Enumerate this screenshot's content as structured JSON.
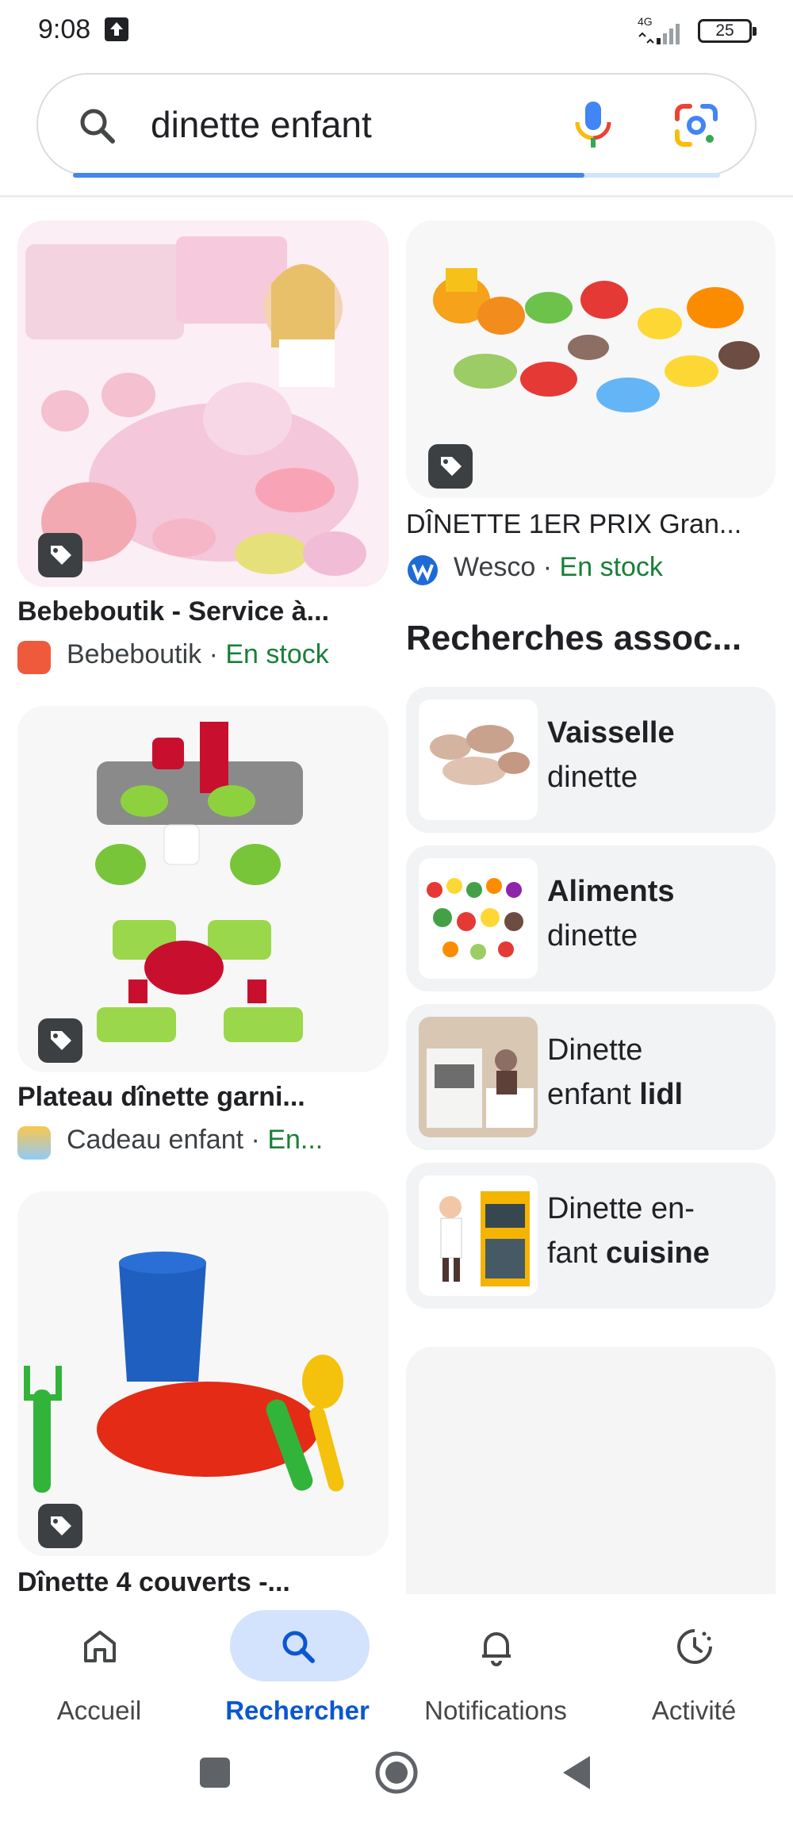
{
  "status_bar": {
    "time": "9:08",
    "network": "4G",
    "battery": "25"
  },
  "search": {
    "query": "dinette enfant",
    "progress": 0.79
  },
  "results": {
    "left": [
      {
        "title": "Bebeboutik - Service à...",
        "merchant": "Bebeboutik",
        "separator": "·",
        "stock": "En stock"
      },
      {
        "title": "Plateau dînette garni...",
        "merchant": "Cadeau enfant",
        "separator": "·",
        "stock": "En..."
      },
      {
        "title": "Dînette 4 couverts -..."
      }
    ],
    "right": [
      {
        "title": "DÎNETTE 1ER PRIX Gran...",
        "merchant": "Wesco",
        "separator": "·",
        "stock": "En stock"
      }
    ]
  },
  "related": {
    "heading": "Recherches assoc...",
    "items": [
      {
        "line1": "Vaisselle",
        "line2": "dinette",
        "bold": "line1"
      },
      {
        "line1": "Aliments",
        "line2": "dinette",
        "bold": "line1"
      },
      {
        "line1": "Dinette",
        "line2_prefix": "enfant ",
        "line2_bold": "lidl"
      },
      {
        "line1": "Dinette en-",
        "line2_prefix": "fant ",
        "line2_bold": "cuisine"
      }
    ]
  },
  "bottom_nav": {
    "items": [
      {
        "label": "Accueil",
        "icon": "home-icon",
        "active": false
      },
      {
        "label": "Rechercher",
        "icon": "search-icon",
        "active": true
      },
      {
        "label": "Notifications",
        "icon": "bell-icon",
        "active": false
      },
      {
        "label": "Activité",
        "icon": "activity-icon",
        "active": false
      }
    ]
  },
  "colors": {
    "accent": "#0b57d0",
    "in_stock": "#188038",
    "active_pill": "#d3e3fd"
  }
}
